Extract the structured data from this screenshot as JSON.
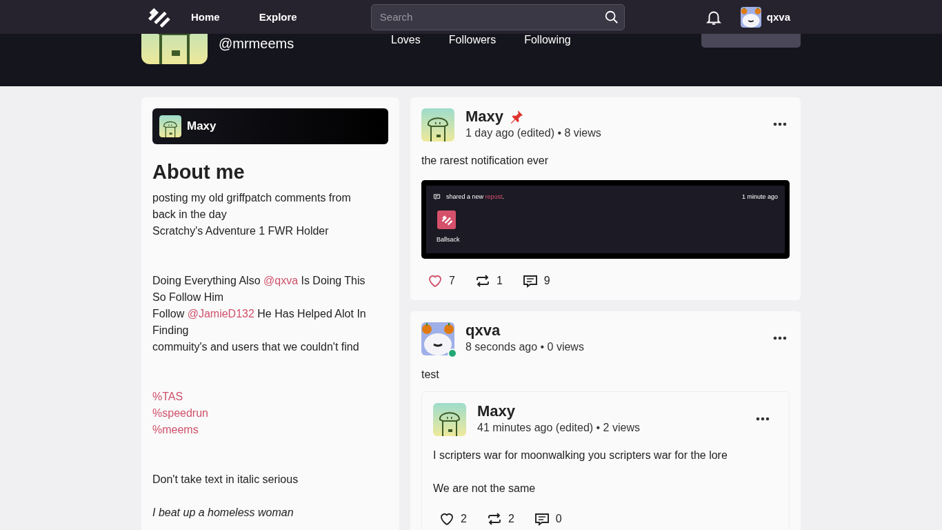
{
  "nav": {
    "links": [
      {
        "label": "Home"
      },
      {
        "label": "Explore"
      }
    ],
    "search": {
      "placeholder": "Search"
    },
    "user": {
      "name": "qxva",
      "avatar": {
        "kind": "cat"
      }
    }
  },
  "profile": {
    "avatar": {
      "kind": "kettle"
    },
    "handle": "@mrmeems",
    "stats": [
      {
        "label": "Loves"
      },
      {
        "label": "Followers"
      },
      {
        "label": "Following"
      }
    ]
  },
  "about": {
    "user": {
      "name": "Maxy",
      "avatar": {
        "kind": "kettle"
      }
    },
    "title": "About me",
    "paragraphs": [
      {
        "kind": "wide",
        "lines": [
          [
            {
              "kind": "text",
              "text": "posting my old griffpatch comments from back in the day"
            }
          ],
          [
            {
              "kind": "text",
              "text": "Scratchy's Adventure 1 FWR Holder"
            }
          ]
        ]
      },
      {
        "kind": "wide",
        "lines": [
          [
            {
              "kind": "text",
              "text": "Doing Everything Also "
            },
            {
              "kind": "mention",
              "text": "@qxva"
            },
            {
              "kind": "text",
              "text": " Is Doing This So Follow Him"
            }
          ],
          [
            {
              "kind": "text",
              "text": "Follow "
            },
            {
              "kind": "mention",
              "text": "@JamieD132"
            },
            {
              "kind": "text",
              "text": " He Has Helped Alot In Finding"
            }
          ],
          [
            {
              "kind": "text",
              "text": "commuity's and users that we couldn't find"
            }
          ]
        ]
      },
      {
        "kind": "wide",
        "lines": [
          [
            {
              "kind": "tag",
              "text": "%TAS"
            }
          ],
          [
            {
              "kind": "tag",
              "text": "%speedrun"
            }
          ],
          [
            {
              "kind": "tag",
              "text": "%meems"
            }
          ]
        ]
      },
      {
        "kind": "close",
        "lines": [
          [
            {
              "kind": "text",
              "text": "Don't take text in italic serious"
            }
          ]
        ]
      },
      {
        "kind": "wide",
        "lines": [
          [
            {
              "kind": "italic",
              "text": "I beat up a homeless woman"
            }
          ]
        ]
      }
    ]
  },
  "posts": [
    {
      "author": "Maxy",
      "avatar": {
        "kind": "kettle"
      },
      "online": false,
      "pinned": true,
      "meta": "1 day ago (edited) • 8 views",
      "body": [
        "the rarest notification ever"
      ],
      "attachment": {
        "kind": "notification-screenshot",
        "parts": [
          {
            "kind": "text",
            "text": "shared a new "
          },
          {
            "kind": "link",
            "text": "repost"
          },
          {
            "kind": "text",
            "text": "."
          }
        ],
        "time": "1 minute ago",
        "app": "Ballsack"
      },
      "stats": {
        "liked": true,
        "likes": "7",
        "reposts": "1",
        "comments": "9"
      }
    },
    {
      "author": "qxva",
      "avatar": {
        "kind": "cat"
      },
      "online": true,
      "pinned": false,
      "meta": "8 seconds ago • 0 views",
      "body": [
        "test"
      ],
      "repost": {
        "author": "Maxy",
        "avatar": {
          "kind": "kettle"
        },
        "online": false,
        "pinned": false,
        "meta": "41 minutes ago (edited) • 2 views",
        "body": [
          "I scripters war for moonwalking you scripters war for the lore",
          "We are not the same"
        ],
        "stats": {
          "liked": false,
          "likes": "2",
          "reposts": "2",
          "comments": "0"
        }
      }
    }
  ]
}
